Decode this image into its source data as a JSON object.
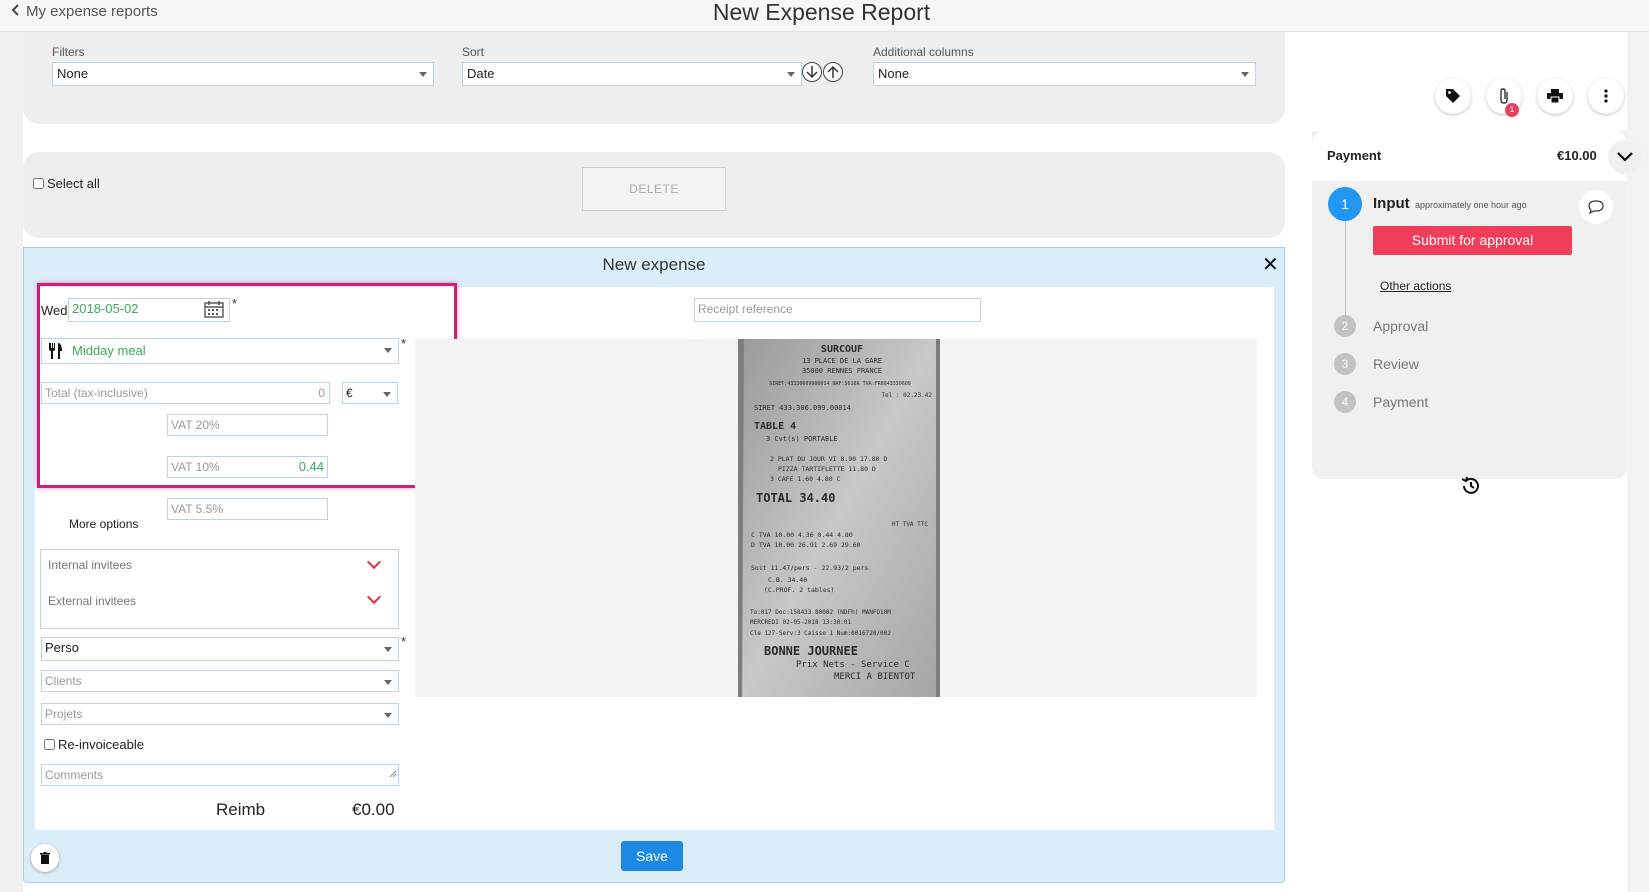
{
  "header": {
    "back_label": "My expense reports",
    "title": "New Expense Report"
  },
  "filters": {
    "filters_label": "Filters",
    "filters_value": "None",
    "sort_label": "Sort",
    "sort_value": "Date",
    "columns_label": "Additional columns",
    "columns_value": "None"
  },
  "selection": {
    "select_all_label": "Select all",
    "delete_label": "DELETE"
  },
  "expense": {
    "modal_title": "New expense",
    "weekday": "Wed",
    "date": "2018-05-02",
    "required_mark": "*",
    "category": "Midday meal",
    "total_placeholder": "Total (tax-inclusive)",
    "total_value": "0",
    "currency": "€",
    "vat20_placeholder": "VAT 20%",
    "vat10_placeholder": "VAT 10%",
    "vat10_value": "0.44",
    "vat55_placeholder": "VAT 5.5%",
    "more_options": "More options",
    "internal_invitees": "Internal invitees",
    "external_invitees": "External invitees",
    "account": "Perso",
    "clients_placeholder": "Clients",
    "projects_placeholder": "Projets",
    "reinvoiceable_label": "Re-invoiceable",
    "comments_placeholder": "Comments",
    "reimb_label": "Reimb",
    "reimb_value": "€0.00",
    "receipt_ref_placeholder": "Receipt reference",
    "save_label": "Save"
  },
  "receipt": {
    "lines": [
      "SURCOUF",
      "13 PLACE DE LA GARE",
      "35000 RENNES FRANCE",
      "SIRET:43330609900014 NAF:5610A TVA:FR6643330609",
      "Tel : 02.23.42",
      "SIRET 433.306.099.00014",
      "TABLE 4",
      "3 Cvt(s) PORTABLE",
      "2 PLAT DU JOUR VI 8.90 17.80 D",
      "PIZZA TARTIFLETTE 11.80 D",
      "3 CAFE 1.60 4.80 C",
      "TOTAL 34.40",
      "HT TVA TTC",
      "C TVA 10.00 4.36 0.44 4.80",
      "D TVA 10.00 26.91 2.69 29.60",
      "Soit 11.47/pers - 22.93/2 pers",
      "C.B. 34.40",
      "(C.PROF. 2 tables)",
      "To:017 Doc:158433 80002 (NDFh) MANFO10M",
      "MERCREDI 02-05-2018 13:30:01",
      "Cle 127-Serv:3 Caisse 1 Num:0016720/002",
      "BONNE JOURNEE",
      "Prix Nets - Service C",
      "MERCI A BIENTOT"
    ]
  },
  "workflow": {
    "title": "Payment",
    "amount": "€10.00",
    "attachment_count": "1",
    "step1_num": "1",
    "step1_label": "Input",
    "step1_time": "approximately one hour ago",
    "submit_label": "Submit for approval",
    "other_actions": "Other actions",
    "steps": [
      {
        "num": "2",
        "label": "Approval"
      },
      {
        "num": "3",
        "label": "Review"
      },
      {
        "num": "4",
        "label": "Payment"
      }
    ]
  },
  "colors": {
    "accent_blue": "#2196f3",
    "submit_red": "#ef3d5a",
    "highlight_pink": "#d21d7a",
    "value_green": "#3aaa5a"
  }
}
